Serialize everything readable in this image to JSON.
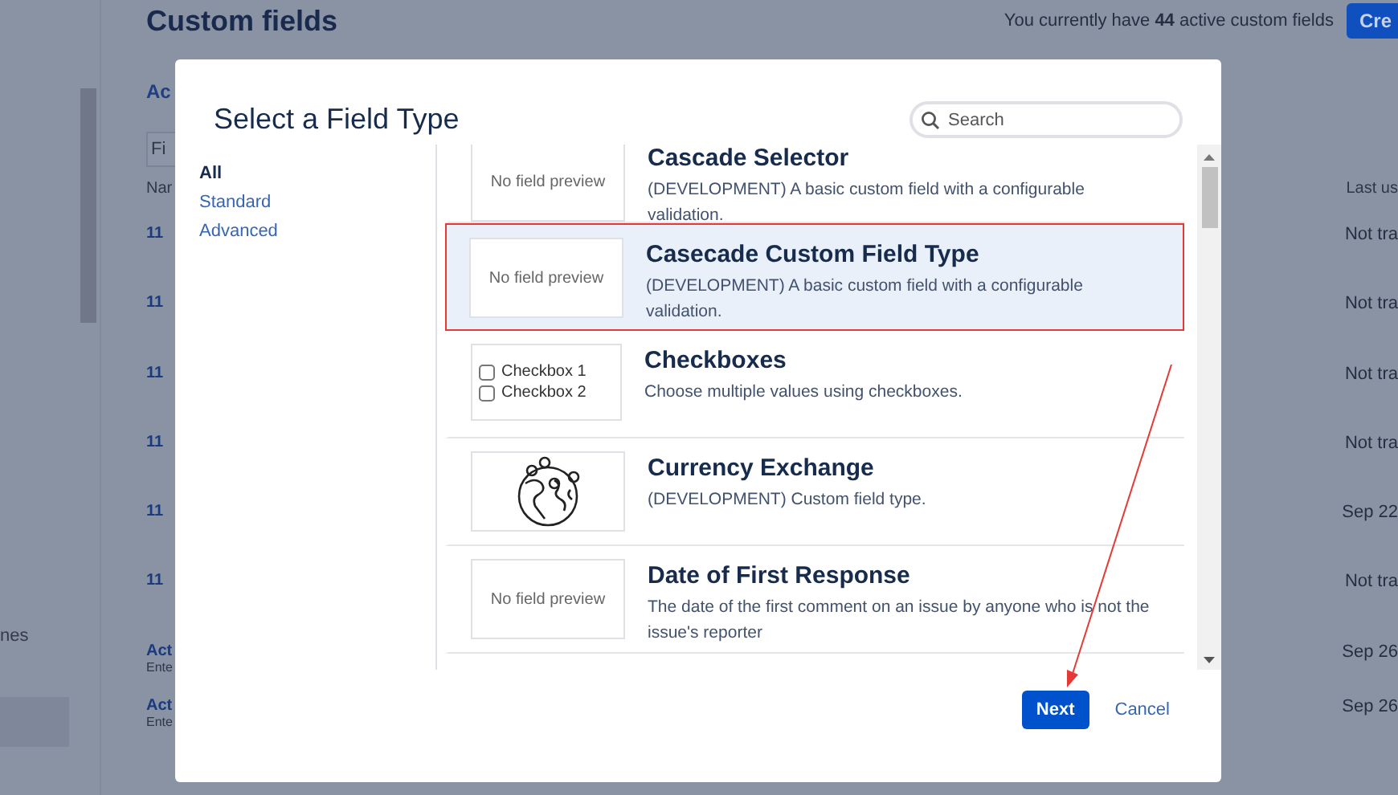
{
  "page": {
    "title": "Custom fields",
    "summary": "You currently have **44** active custom fields",
    "create_button": "Cre",
    "tab": "Ac",
    "filter_placeholder": "Fi",
    "columns": {
      "name": "Nar",
      "last_used": "Last us"
    },
    "sidebar_text": "nes",
    "rows": [
      {
        "name": "11",
        "last_used": "Not tra"
      },
      {
        "name": "11",
        "last_used": "Not tra"
      },
      {
        "name": "11",
        "last_used": "Not tra"
      },
      {
        "name": "11",
        "last_used": "Not tra"
      },
      {
        "name": "11",
        "last_used": "Sep 22"
      },
      {
        "name": "11",
        "last_used": "Not tra"
      },
      {
        "name": "Act",
        "sub": "Ente",
        "last_used": "Sep 26"
      },
      {
        "name": "Act",
        "sub": "Ente",
        "last_used": "Sep 26"
      }
    ]
  },
  "dialog": {
    "title": "Select a Field Type",
    "search": {
      "placeholder": "Search"
    },
    "categories": [
      {
        "label": "All",
        "selected": true
      },
      {
        "label": "Standard",
        "selected": false
      },
      {
        "label": "Advanced",
        "selected": false
      }
    ],
    "field_types": [
      {
        "name": "Cascade Selector",
        "description": "(DEVELOPMENT) A basic custom field with a configurable validation.",
        "preview": {
          "kind": "text",
          "text": "No field preview"
        },
        "selected": false
      },
      {
        "name": "Casecade Custom Field Type",
        "description": "(DEVELOPMENT) A basic custom field with a configurable validation.",
        "preview": {
          "kind": "text",
          "text": "No field preview"
        },
        "selected": true
      },
      {
        "name": "Checkboxes",
        "description": "Choose multiple values using checkboxes.",
        "preview": {
          "kind": "checkboxes",
          "options": [
            {
              "label": "Checkbox 1",
              "checked": false
            },
            {
              "label": "Checkbox 2",
              "checked": false
            }
          ]
        },
        "selected": false
      },
      {
        "name": "Currency Exchange",
        "description": "(DEVELOPMENT) Custom field type.",
        "preview": {
          "kind": "globe"
        },
        "selected": false
      },
      {
        "name": "Date of First Response",
        "description": "The date of the first comment on an issue by anyone who is not the issue's reporter",
        "preview": {
          "kind": "text",
          "text": "No field preview"
        },
        "selected": false
      }
    ],
    "buttons": {
      "primary": "Next",
      "secondary": "Cancel"
    }
  }
}
